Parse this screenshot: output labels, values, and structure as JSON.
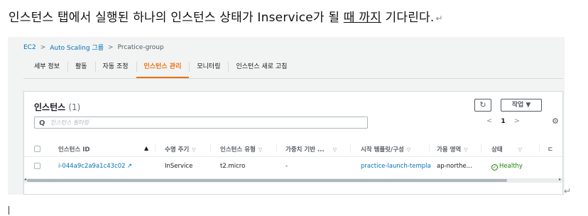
{
  "doc": {
    "line_before": "인스턴스 탭에서 실행된 하나의 인스턴스 상태가 Inservice가 될 ",
    "line_highlight": "때 까지",
    "line_after": " 기다린다.",
    "para_mark": "↵"
  },
  "breadcrumb": {
    "items": [
      "EC2",
      "Auto Scaling 그룹",
      "Prcatice-group"
    ],
    "separator": ">"
  },
  "tabs": [
    "세부 정보",
    "활동",
    "자동 조정",
    "인스턴스 관리",
    "모니터링",
    "인스턴스 새로 고침"
  ],
  "active_tab": "인스턴스 관리",
  "panel": {
    "title": "인스턴스",
    "count": "(1)",
    "refresh_glyph": "↻",
    "actions_label": "작업 ▼",
    "search_placeholder": "인스턴스 필터링",
    "search_glyph": "Q",
    "pager": {
      "prev": "<",
      "page": "1",
      "next": ">"
    },
    "settings_glyph": "⚙"
  },
  "table": {
    "columns": [
      {
        "label": "인스턴스 ID",
        "sort": "▲"
      },
      {
        "label": "수명 주기",
        "sort": "▽"
      },
      {
        "label": "인스턴스 유형",
        "sort": "▽"
      },
      {
        "label": "가중치 기반 ...",
        "sort": "▽"
      },
      {
        "label": "시작 템플릿/구성",
        "sort": "▽"
      },
      {
        "label": "가용 영역",
        "sort": "▽"
      },
      {
        "label": "상태",
        "sort": "▽"
      },
      {
        "label": "ㄷ",
        "sort": ""
      }
    ],
    "rows": [
      {
        "instance_id": "i-044a9c2a9a1c43c02",
        "ext_glyph": "↗",
        "lifecycle": "InService",
        "instance_type": "t2.micro",
        "weight": "-",
        "launch_template": "practice-launch-templa",
        "availability_zone": "ap-northe...",
        "health": "Healthy",
        "health_glyph": "✓"
      }
    ]
  },
  "colors": {
    "accent": "#ec7211",
    "link": "#0073bb",
    "healthy": "#1d8102"
  }
}
